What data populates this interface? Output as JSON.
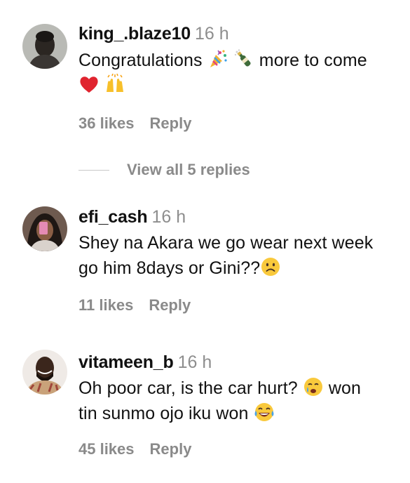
{
  "comments": [
    {
      "username": "king_.blaze10",
      "time": "16 h",
      "text_part1": "Congratulations",
      "text_part2": "more to come",
      "likes": "36 likes",
      "reply": "Reply"
    },
    {
      "username": "efi_cash",
      "time": "16 h",
      "text_line1": "Shey na Akara we go wear next week",
      "text_line2": "go him 8days or Gini??",
      "likes": "11 likes",
      "reply": "Reply"
    },
    {
      "username": "vitameen_b",
      "time": "16 h",
      "text_part1": "Oh poor car, is the car hurt?",
      "text_part2": "won",
      "text_line2": "tin sunmo ojo iku won",
      "likes": "45 likes",
      "reply": "Reply"
    }
  ],
  "view_replies": "View all 5 replies",
  "icons": [
    "party-popper-icon",
    "champagne-icon",
    "red-heart-icon",
    "raising-hands-icon",
    "slightly-frowning-face-icon",
    "crying-face-icon",
    "tears-of-joy-icon"
  ]
}
